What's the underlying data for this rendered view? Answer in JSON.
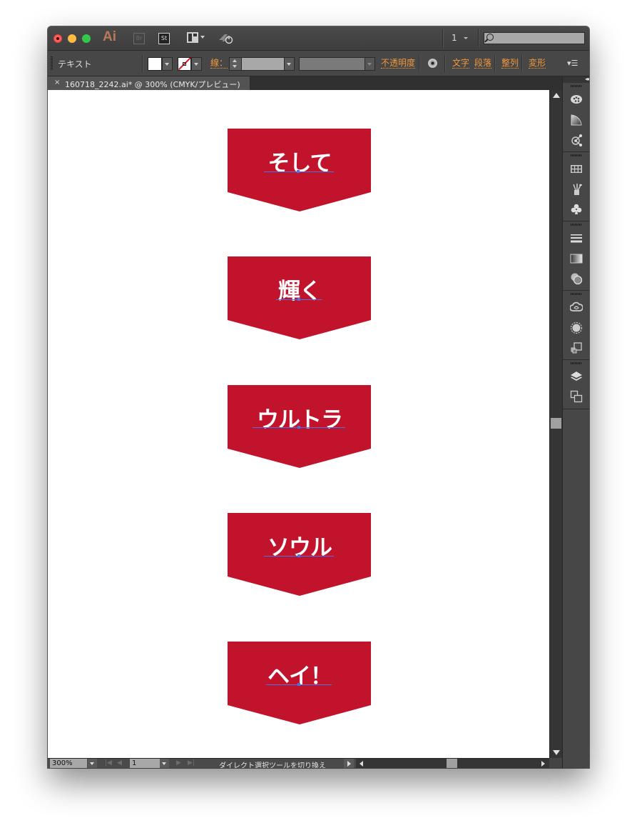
{
  "window": {
    "app_logo": "Ai",
    "bridge_label": "Br",
    "stock_label": "St",
    "artboard_number": "1",
    "search_placeholder": ""
  },
  "control_bar": {
    "object_type": "テキスト",
    "stroke_label": "線：",
    "links": [
      "不透明度",
      "文字",
      "段落",
      "整列",
      "変形"
    ],
    "panel_menu": "▾☰"
  },
  "document_tab": {
    "close": "×",
    "title": "160718_2242.ai* @ 300% (CMYK/プレビュー)"
  },
  "artboard": {
    "banner_color": "#c1132b",
    "text_color": "#ffffff",
    "banners": [
      {
        "text": "そして"
      },
      {
        "text": "輝く"
      },
      {
        "text": "ウルトラ"
      },
      {
        "text": "ソウル"
      },
      {
        "text": "ヘイ！"
      }
    ]
  },
  "status_bar": {
    "zoom": "300%",
    "page": "1",
    "status_text": "ダイレクト選択ツールを切り換え",
    "nav_first": "|◀",
    "nav_prev": "◀",
    "nav_next": "▶",
    "nav_last": "▶|"
  },
  "dock": {
    "collapse": "◂◂",
    "groups": [
      [
        "color-palette-icon",
        "color-guide-icon",
        "recolor-artwork-icon"
      ],
      [
        "swatches-icon",
        "brushes-icon",
        "symbols-icon"
      ],
      [
        "stroke-icon",
        "gradient-icon",
        "transparency-icon"
      ],
      [
        "cc-libraries-icon",
        "appearance-icon",
        "graphic-styles-icon"
      ],
      [
        "layers-icon",
        "artboards-icon"
      ]
    ]
  }
}
